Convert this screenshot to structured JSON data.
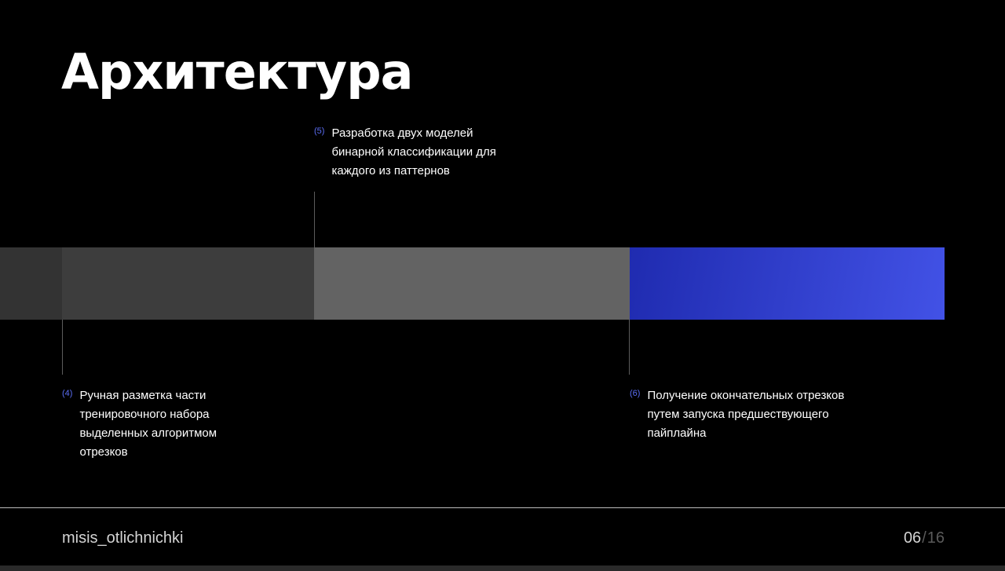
{
  "slide": {
    "title": "Архитектура"
  },
  "timeline": {
    "segments": [
      {
        "color": "#333333"
      },
      {
        "color": "#3d3d3d"
      },
      {
        "color": "#636363"
      },
      {
        "gradient_from": "#1f2bb0",
        "gradient_to": "#4252e6"
      }
    ],
    "steps": [
      {
        "number": "(4)",
        "text": "Ручная разметка части тренировочного набора выделенных алгоритмом отрезков"
      },
      {
        "number": "(5)",
        "text": "Разработка двух моделей бинарной классификации для каждого из паттернов"
      },
      {
        "number": "(6)",
        "text": "Получение окончательных отрезков путем запуска предшествующего пайплайна"
      }
    ],
    "step_number_color": "#5b6ef5"
  },
  "footer": {
    "brand": "misis_otlichnichki",
    "page_current": "06",
    "page_separator": "/",
    "page_total": "16",
    "current_color": "#d4d4d4",
    "total_color": "#5a5a5a",
    "bottom_edge_color": "#2a2a2a"
  }
}
